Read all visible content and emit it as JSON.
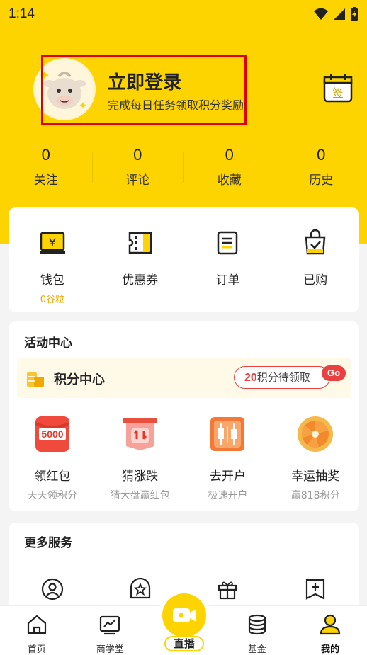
{
  "status": {
    "time": "1:14"
  },
  "profile": {
    "login_title": "立即登录",
    "login_subtitle": "完成每日任务领取积分奖励",
    "checkin_char": "签"
  },
  "stats": [
    {
      "value": "0",
      "label": "关注"
    },
    {
      "value": "0",
      "label": "评论"
    },
    {
      "value": "0",
      "label": "收藏"
    },
    {
      "value": "0",
      "label": "历史"
    }
  ],
  "wallet": [
    {
      "label": "钱包",
      "sub": "0谷粒",
      "icon": "wallet-icon"
    },
    {
      "label": "优惠券",
      "sub": "",
      "icon": "coupon-icon"
    },
    {
      "label": "订单",
      "sub": "",
      "icon": "order-icon"
    },
    {
      "label": "已购",
      "sub": "",
      "icon": "purchased-icon"
    }
  ],
  "activity": {
    "title": "活动中心",
    "points_title": "积分中心",
    "points_count": "20",
    "points_text": "积分待领取",
    "go": "Go",
    "items": [
      {
        "label": "领红包",
        "sub": "天天领积分",
        "icon": "red-packet-icon",
        "badge": "5000"
      },
      {
        "label": "猜涨跌",
        "sub": "猜大盘赢红包",
        "icon": "guess-icon"
      },
      {
        "label": "去开户",
        "sub": "极速开户",
        "icon": "open-account-icon"
      },
      {
        "label": "幸运抽奖",
        "sub": "赢818积分",
        "icon": "lucky-wheel-icon"
      }
    ]
  },
  "services": {
    "title": "更多服务",
    "items": [
      {
        "icon": "user-circle-icon"
      },
      {
        "icon": "star-badge-icon"
      },
      {
        "icon": "gift-icon"
      },
      {
        "icon": "bookmark-add-icon"
      }
    ]
  },
  "tabbar": [
    {
      "label": "首页",
      "icon": "home-icon"
    },
    {
      "label": "商学堂",
      "icon": "chart-icon"
    },
    {
      "label": "直播",
      "icon": "video-icon"
    },
    {
      "label": "基金",
      "icon": "coins-stack-icon"
    },
    {
      "label": "我的",
      "icon": "user-icon",
      "active": true
    }
  ],
  "colors": {
    "brand_yellow": "#fdd400",
    "accent_red": "#e94040",
    "sub_orange": "#f0a800"
  }
}
